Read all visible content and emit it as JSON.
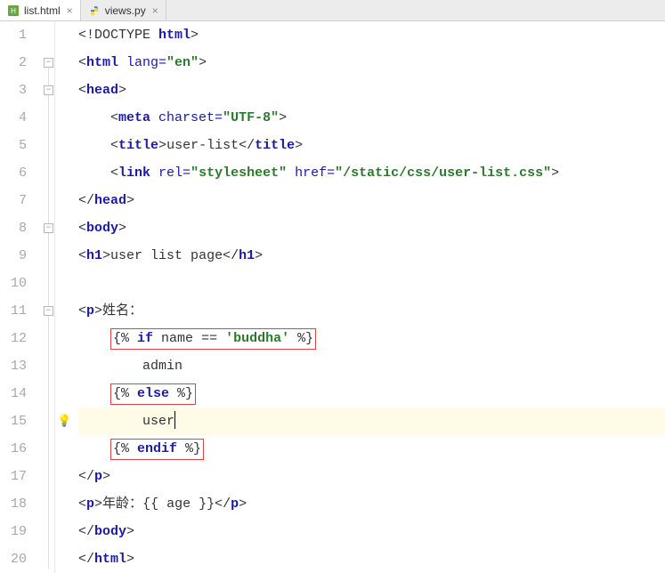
{
  "tabs": [
    {
      "label": "list.html",
      "active": true,
      "icon": "html-file-icon"
    },
    {
      "label": "views.py",
      "active": false,
      "icon": "python-file-icon"
    }
  ],
  "lines": [
    1,
    2,
    3,
    4,
    5,
    6,
    7,
    8,
    9,
    10,
    11,
    12,
    13,
    14,
    15,
    16,
    17,
    18,
    19,
    20
  ],
  "code": {
    "l1": {
      "doctype": "<!DOCTYPE ",
      "html": "html",
      "close": ">"
    },
    "l2": {
      "open": "<html ",
      "attr": "lang=",
      "val": "\"en\"",
      "close": ">"
    },
    "l3": {
      "open": "<head>",
      "close": ""
    },
    "l4": {
      "open": "<meta ",
      "attr": "charset=",
      "val": "\"UTF-8\"",
      "close": ">"
    },
    "l5": {
      "open": "<title>",
      "text": "user-list",
      "close": "</title>"
    },
    "l6": {
      "open": "<link ",
      "attr1": "rel=",
      "val1": "\"stylesheet\"",
      "attr2": " href=",
      "val2": "\"/static/css/user-list.css\"",
      "close": ">"
    },
    "l7": {
      "close": "</head>"
    },
    "l8": {
      "open": "<body>"
    },
    "l9": {
      "open": "<h1>",
      "text": "user list page",
      "close": "</h1>"
    },
    "l11": {
      "open": "<p>",
      "text": "姓名："
    },
    "l12": {
      "td": "{% ",
      "kw": "if",
      "rest1": " name ",
      "op": "==",
      "rest2": " ",
      "str": "'buddha'",
      "end": " %}"
    },
    "l13": {
      "text": "admin"
    },
    "l14": {
      "td": "{% ",
      "kw": "else",
      "end": " %}"
    },
    "l15": {
      "text": "user"
    },
    "l16": {
      "td": "{% ",
      "kw": "endif",
      "end": " %}"
    },
    "l17": {
      "close": "</p>"
    },
    "l18": {
      "open": "<p>",
      "text1": "年龄：",
      "tv": "{{ age }}",
      "close": "</p>"
    },
    "l19": {
      "close": "</body>"
    },
    "l20": {
      "close": "</html>"
    }
  }
}
